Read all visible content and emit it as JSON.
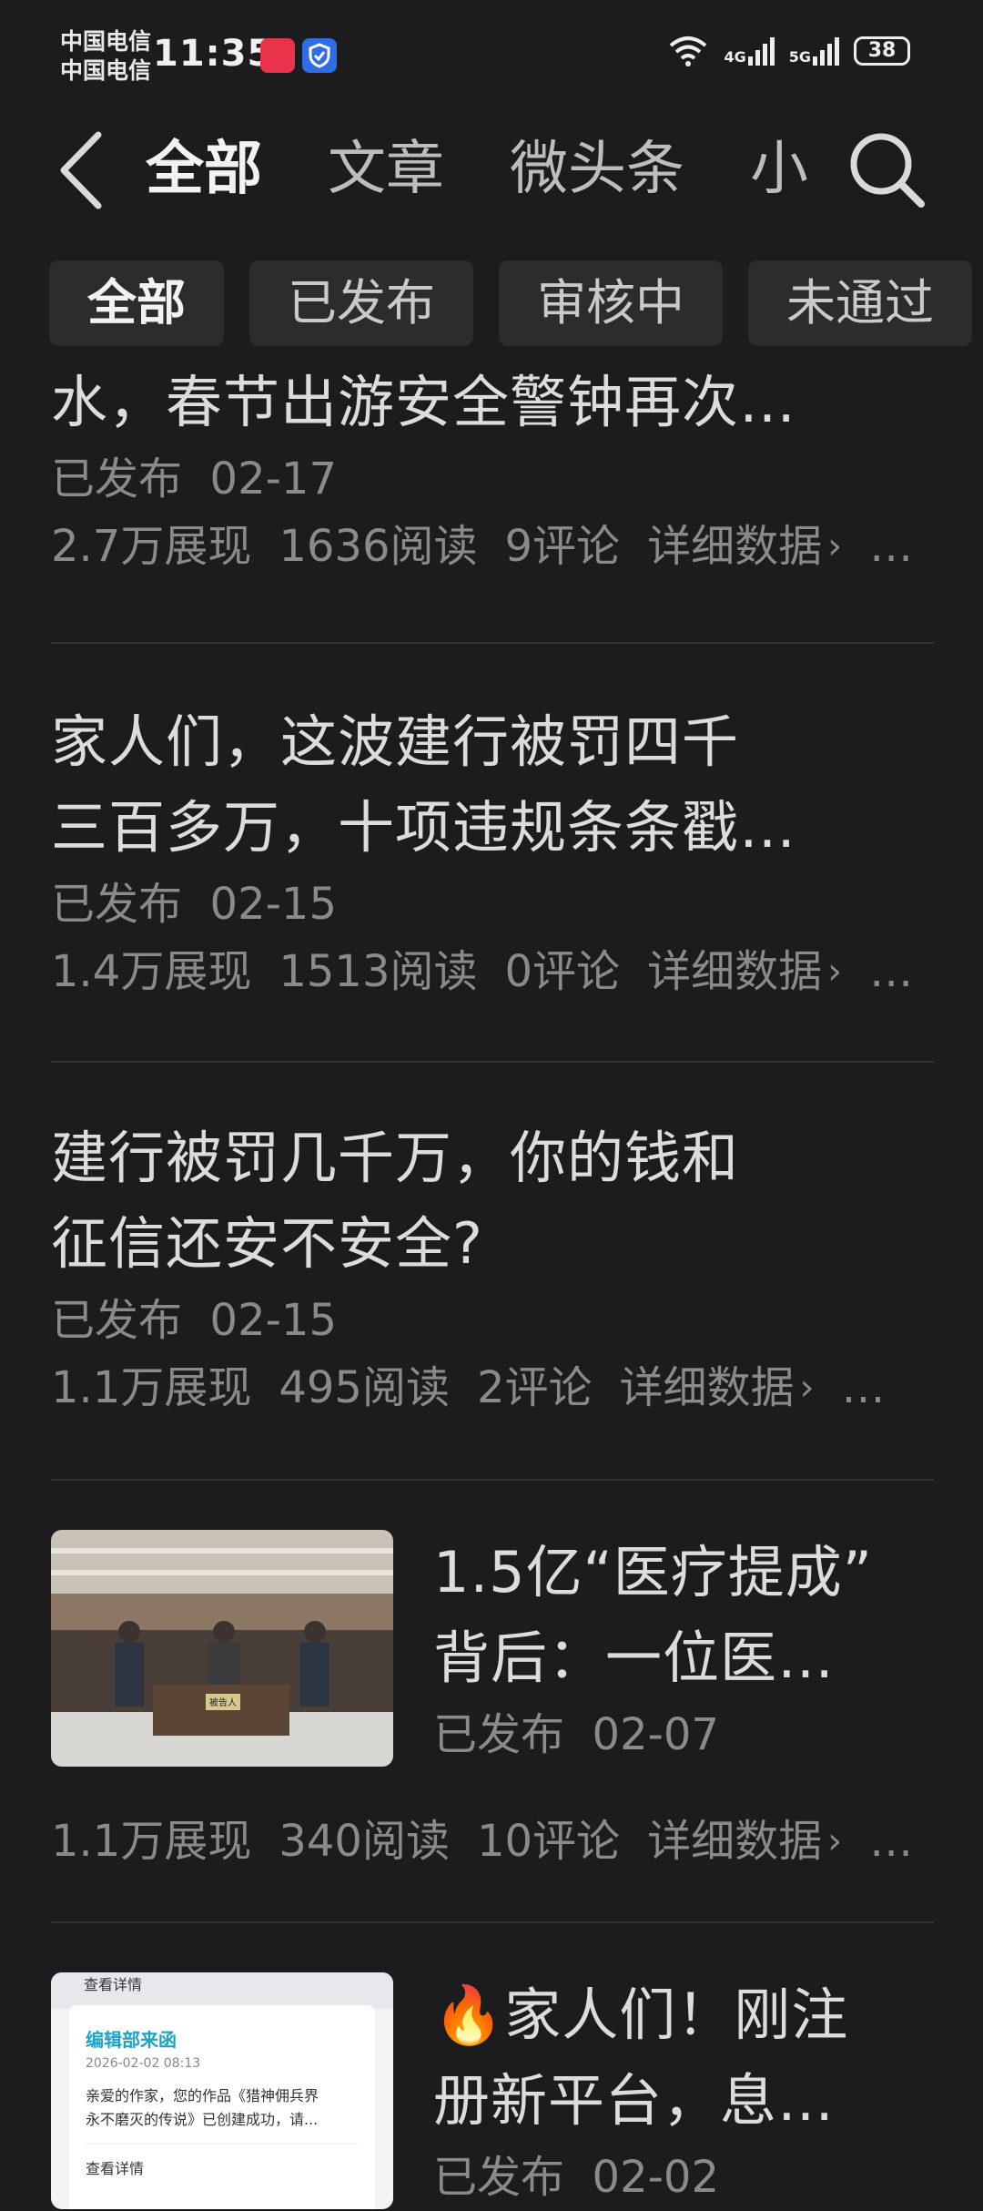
{
  "status_bar": {
    "carrier1": "中国电信",
    "carrier2": "中国电信",
    "time": "11:35",
    "network1": "4G",
    "network2": "5G",
    "battery": "38"
  },
  "header": {
    "tabs": [
      "全部",
      "文章",
      "微头条",
      "小"
    ]
  },
  "filters": [
    "全部",
    "已发布",
    "审核中",
    "未通过"
  ],
  "articles": [
    {
      "title_lines": [
        "水，春节出游安全警钟再次…"
      ],
      "status": "已发布",
      "date": "02-17",
      "impressions": "2.7万展现",
      "reads": "1636阅读",
      "comments": "9评论",
      "detail": "详细数据"
    },
    {
      "title_lines": [
        "家人们，这波建行被罚四千",
        "三百多万，十项违规条条戳…"
      ],
      "status": "已发布",
      "date": "02-15",
      "impressions": "1.4万展现",
      "reads": "1513阅读",
      "comments": "0评论",
      "detail": "详细数据"
    },
    {
      "title_lines": [
        "建行被罚几千万，你的钱和",
        "征信还安不安全?"
      ],
      "status": "已发布",
      "date": "02-15",
      "impressions": "1.1万展现",
      "reads": "495阅读",
      "comments": "2评论",
      "detail": "详细数据"
    },
    {
      "title_lines": [
        "1.5亿“医疗提成”",
        "背后：一位医…"
      ],
      "status": "已发布",
      "date": "02-07",
      "impressions": "1.1万展现",
      "reads": "340阅读",
      "comments": "10评论",
      "detail": "详细数据",
      "thumb_caption": "被告人"
    },
    {
      "title_lines": [
        "🔥家人们！刚注",
        "册新平台，息…"
      ],
      "status": "已发布",
      "date": "02-02",
      "thumb_card": {
        "top": "查看详情",
        "heading": "编辑部来函",
        "datetime": "2026-02-02 08:13",
        "body1": "亲爱的作家，您的作品《猎神佣兵界",
        "body2": "永不磨灭的传说》已创建成功，请...",
        "link": "查看详情"
      }
    }
  ]
}
